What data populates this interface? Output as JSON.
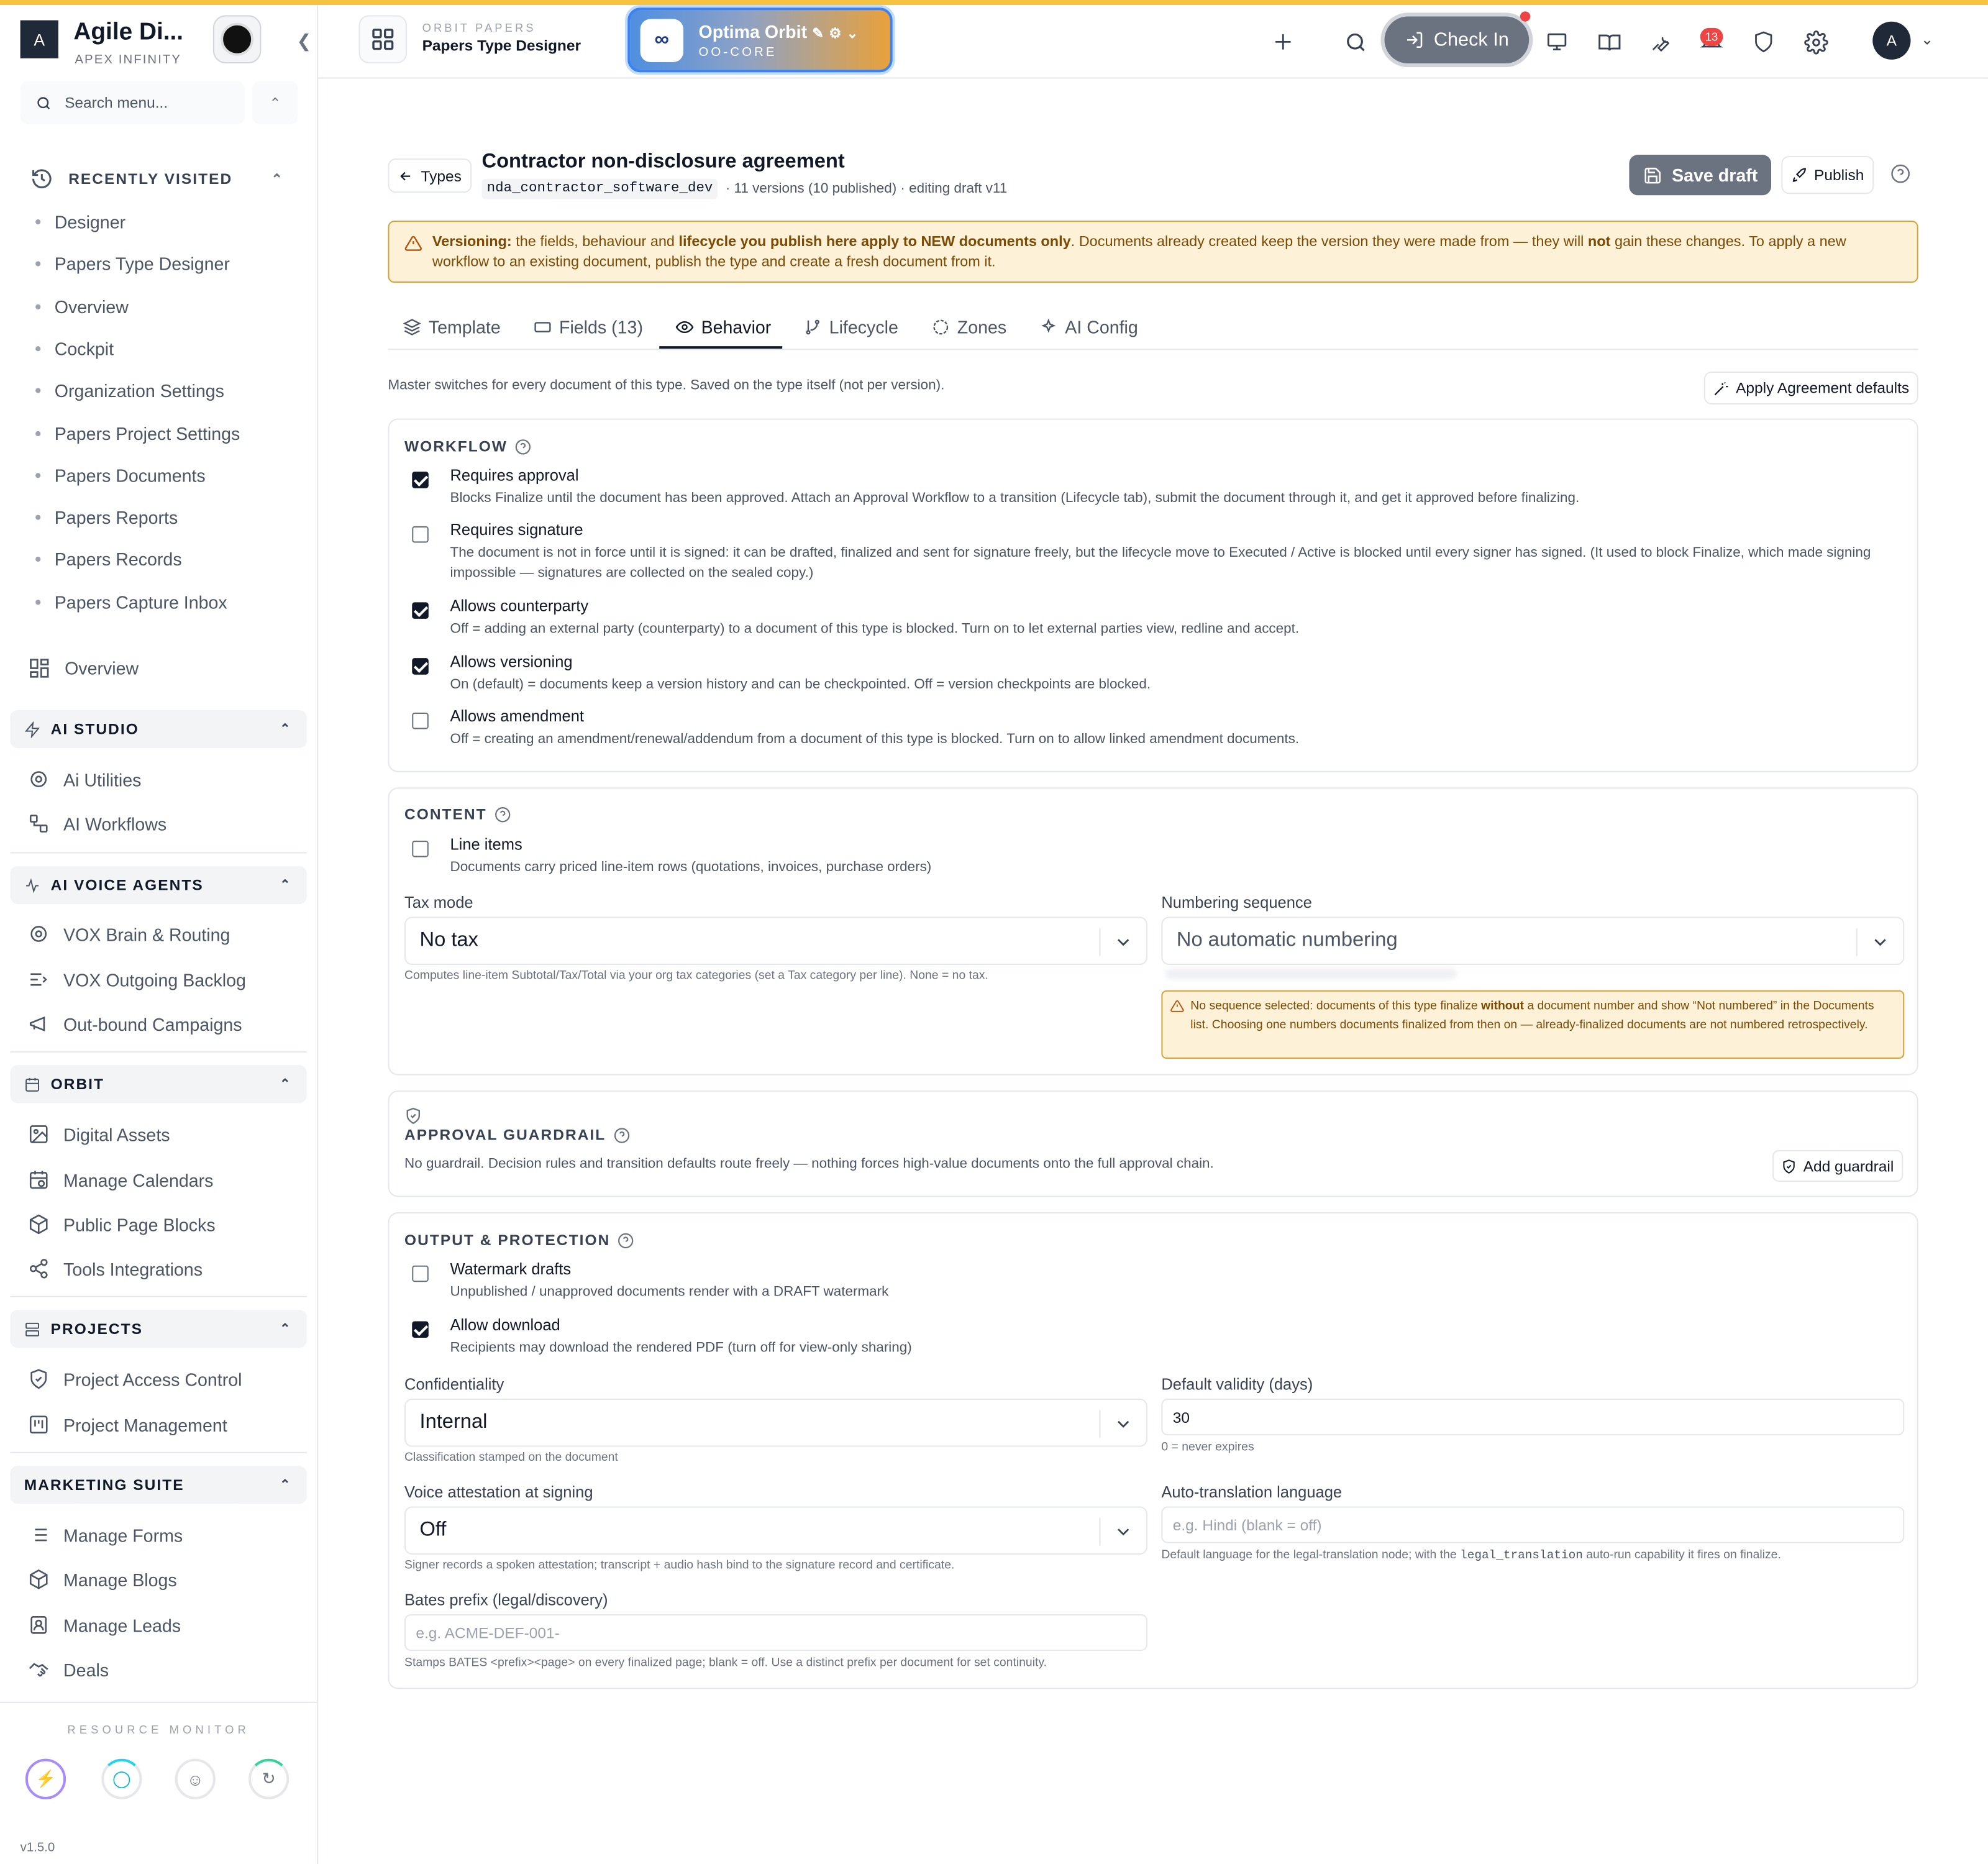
{
  "colors": {
    "topline": "#f5c242",
    "warning_bg": "#fdf1d8",
    "warning_border": "#d4a33a",
    "checkin": "#6b7280",
    "badge": "#ef4444"
  },
  "sidebar": {
    "brand_initial": "A",
    "brand_title": "Agile Di...",
    "brand_subtitle": "APEX INFINITY",
    "search_placeholder": "Search menu...",
    "recently_visited_label": "RECENTLY VISITED",
    "recent": [
      "Designer",
      "Papers Type Designer",
      "Overview",
      "Cockpit",
      "Organization Settings",
      "Papers Project Settings",
      "Papers Documents",
      "Papers Reports",
      "Papers Records",
      "Papers Capture Inbox"
    ],
    "overview": "Overview",
    "groups": [
      {
        "label": "AI STUDIO",
        "icon": "bolt-icon",
        "items": [
          {
            "label": "Ai Utilities",
            "icon": "gear-icon"
          },
          {
            "label": "AI Workflows",
            "icon": "workflow-icon"
          }
        ]
      },
      {
        "label": "AI VOICE AGENTS",
        "icon": "pulse-icon",
        "items": [
          {
            "label": "VOX Brain & Routing",
            "icon": "gear-icon"
          },
          {
            "label": "VOX Outgoing Backlog",
            "icon": "list-arrow-icon"
          },
          {
            "label": "Out-bound Campaigns",
            "icon": "megaphone-icon"
          }
        ]
      },
      {
        "label": "ORBIT",
        "icon": "calendar-icon",
        "items": [
          {
            "label": "Digital Assets",
            "icon": "image-icon"
          },
          {
            "label": "Manage Calendars",
            "icon": "calendar-clock-icon"
          },
          {
            "label": "Public Page Blocks",
            "icon": "cube-icon"
          },
          {
            "label": "Tools Integrations",
            "icon": "share-icon"
          }
        ]
      },
      {
        "label": "PROJECTS",
        "icon": "server-icon",
        "items": [
          {
            "label": "Project Access Control",
            "icon": "shield-icon"
          },
          {
            "label": "Project Management",
            "icon": "kanban-icon"
          }
        ]
      },
      {
        "label": "MARKETING SUITE",
        "icon": "",
        "items": [
          {
            "label": "Manage Forms",
            "icon": "list-icon"
          },
          {
            "label": "Manage Blogs",
            "icon": "cube-icon"
          },
          {
            "label": "Manage Leads",
            "icon": "contact-icon"
          },
          {
            "label": "Deals",
            "icon": "handshake-icon"
          }
        ]
      }
    ],
    "resource_monitor_label": "RESOURCE MONITOR",
    "version": "v1.5.0"
  },
  "header": {
    "eyebrow": "ORBIT PAPERS",
    "title": "Papers Type Designer",
    "orbit_name": "Optima Orbit",
    "orbit_code": "OO-CORE",
    "checkin_label": "Check In",
    "notif_count": "13",
    "avatar_initial": "A"
  },
  "page": {
    "back_label": "Types",
    "title": "Contractor non-disclosure agreement",
    "code": "nda_contractor_software_dev",
    "meta": "· 11 versions (10 published) · editing draft v11",
    "save_label": "Save draft",
    "publish_label": "Publish",
    "warning": {
      "lead": "Versioning:",
      "t1": " the fields, behaviour and ",
      "b1": "lifecycle you publish here apply to NEW documents only",
      "t2": ". Documents already created keep the version they were made from — they will ",
      "b2": "not",
      "t3": " gain these changes. To apply a new workflow to an existing document, publish the type and create a fresh document from it."
    },
    "tabs": [
      {
        "label": "Template",
        "icon": "layers-icon"
      },
      {
        "label": "Fields (13)",
        "icon": "form-icon"
      },
      {
        "label": "Behavior",
        "icon": "eye-icon"
      },
      {
        "label": "Lifecycle",
        "icon": "branch-icon"
      },
      {
        "label": "Zones",
        "icon": "zone-icon"
      },
      {
        "label": "AI Config",
        "icon": "sparkle-icon"
      }
    ],
    "active_tab": "Behavior",
    "intro": "Master switches for every document of this type. Saved on the type itself (not per version).",
    "apply_label": "Apply Agreement defaults"
  },
  "workflow": {
    "title": "WORKFLOW",
    "options": [
      {
        "label": "Requires approval",
        "checked": true,
        "desc": "Blocks Finalize until the document has been approved. Attach an Approval Workflow to a transition (Lifecycle tab), submit the document through it, and get it approved before finalizing."
      },
      {
        "label": "Requires signature",
        "checked": false,
        "desc": "The document is not in force until it is signed: it can be drafted, finalized and sent for signature freely, but the lifecycle move to Executed / Active is blocked until every signer has signed. (It used to block Finalize, which made signing impossible — signatures are collected on the sealed copy.)"
      },
      {
        "label": "Allows counterparty",
        "checked": true,
        "desc": "Off = adding an external party (counterparty) to a document of this type is blocked. Turn on to let external parties view, redline and accept."
      },
      {
        "label": "Allows versioning",
        "checked": true,
        "desc": "On (default) = documents keep a version history and can be checkpointed. Off = version checkpoints are blocked."
      },
      {
        "label": "Allows amendment",
        "checked": false,
        "desc": "Off = creating an amendment/renewal/addendum from a document of this type is blocked. Turn on to allow linked amendment documents."
      }
    ]
  },
  "content": {
    "title": "CONTENT",
    "line_items": {
      "label": "Line items",
      "checked": false,
      "desc": "Documents carry priced line-item rows (quotations, invoices, purchase orders)"
    },
    "tax_label": "Tax mode",
    "tax_value": "No tax",
    "tax_hint": "Computes line-item Subtotal/Tax/Total via your org tax categories (set a Tax category per line). None = no tax.",
    "num_label": "Numbering sequence",
    "num_value": "No automatic numbering",
    "num_warn": {
      "t1": "No sequence selected: documents of this type finalize ",
      "b1": "without",
      "t2": " a document number and show “Not numbered” in the Documents list. Choosing one numbers documents finalized from then on — already-finalized documents are not numbered retrospectively."
    }
  },
  "guardrail": {
    "title": "APPROVAL GUARDRAIL",
    "desc": "No guardrail. Decision rules and transition defaults route freely — nothing forces high-value documents onto the full approval chain.",
    "button": "Add guardrail"
  },
  "output": {
    "title": "OUTPUT & PROTECTION",
    "options": [
      {
        "label": "Watermark drafts",
        "checked": false,
        "desc": "Unpublished / unapproved documents render with a DRAFT watermark"
      },
      {
        "label": "Allow download",
        "checked": true,
        "desc": "Recipients may download the rendered PDF (turn off for view-only sharing)"
      }
    ],
    "conf_label": "Confidentiality",
    "conf_value": "Internal",
    "conf_hint": "Classification stamped on the document",
    "validity_label": "Default validity (days)",
    "validity_value": "30",
    "validity_hint": "0 = never expires",
    "voice_label": "Voice attestation at signing",
    "voice_value": "Off",
    "voice_hint": "Signer records a spoken attestation; transcript + audio hash bind to the signature record and certificate.",
    "lang_label": "Auto-translation language",
    "lang_placeholder": "e.g. Hindi (blank = off)",
    "lang_hint1": "Default language for the legal-translation node; with the ",
    "lang_hint_code": "legal_translation",
    "lang_hint2": " auto-run capability it fires on finalize.",
    "bates_label": "Bates prefix (legal/discovery)",
    "bates_placeholder": "e.g. ACME-DEF-001-",
    "bates_hint": "Stamps BATES <prefix><page> on every finalized page; blank = off. Use a distinct prefix per document for set continuity."
  }
}
